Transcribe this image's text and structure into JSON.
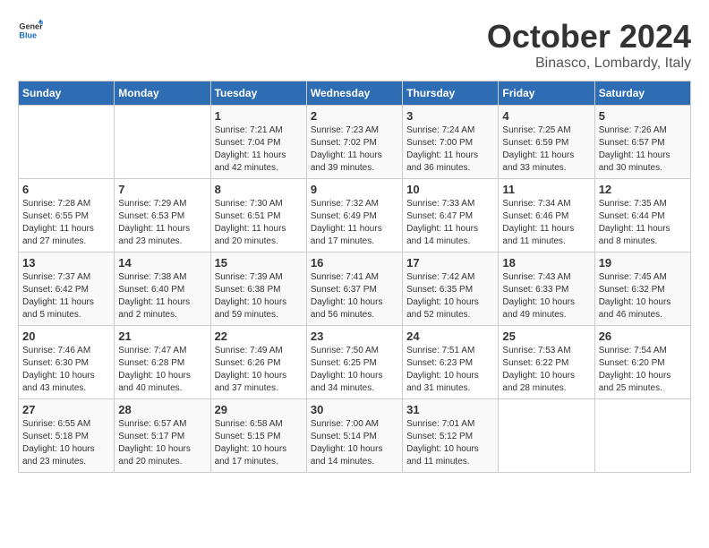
{
  "header": {
    "logo_general": "General",
    "logo_blue": "Blue",
    "month": "October 2024",
    "location": "Binasco, Lombardy, Italy"
  },
  "days_of_week": [
    "Sunday",
    "Monday",
    "Tuesday",
    "Wednesday",
    "Thursday",
    "Friday",
    "Saturday"
  ],
  "weeks": [
    [
      {
        "day": "",
        "info": ""
      },
      {
        "day": "",
        "info": ""
      },
      {
        "day": "1",
        "info": "Sunrise: 7:21 AM\nSunset: 7:04 PM\nDaylight: 11 hours and 42 minutes."
      },
      {
        "day": "2",
        "info": "Sunrise: 7:23 AM\nSunset: 7:02 PM\nDaylight: 11 hours and 39 minutes."
      },
      {
        "day": "3",
        "info": "Sunrise: 7:24 AM\nSunset: 7:00 PM\nDaylight: 11 hours and 36 minutes."
      },
      {
        "day": "4",
        "info": "Sunrise: 7:25 AM\nSunset: 6:59 PM\nDaylight: 11 hours and 33 minutes."
      },
      {
        "day": "5",
        "info": "Sunrise: 7:26 AM\nSunset: 6:57 PM\nDaylight: 11 hours and 30 minutes."
      }
    ],
    [
      {
        "day": "6",
        "info": "Sunrise: 7:28 AM\nSunset: 6:55 PM\nDaylight: 11 hours and 27 minutes."
      },
      {
        "day": "7",
        "info": "Sunrise: 7:29 AM\nSunset: 6:53 PM\nDaylight: 11 hours and 23 minutes."
      },
      {
        "day": "8",
        "info": "Sunrise: 7:30 AM\nSunset: 6:51 PM\nDaylight: 11 hours and 20 minutes."
      },
      {
        "day": "9",
        "info": "Sunrise: 7:32 AM\nSunset: 6:49 PM\nDaylight: 11 hours and 17 minutes."
      },
      {
        "day": "10",
        "info": "Sunrise: 7:33 AM\nSunset: 6:47 PM\nDaylight: 11 hours and 14 minutes."
      },
      {
        "day": "11",
        "info": "Sunrise: 7:34 AM\nSunset: 6:46 PM\nDaylight: 11 hours and 11 minutes."
      },
      {
        "day": "12",
        "info": "Sunrise: 7:35 AM\nSunset: 6:44 PM\nDaylight: 11 hours and 8 minutes."
      }
    ],
    [
      {
        "day": "13",
        "info": "Sunrise: 7:37 AM\nSunset: 6:42 PM\nDaylight: 11 hours and 5 minutes."
      },
      {
        "day": "14",
        "info": "Sunrise: 7:38 AM\nSunset: 6:40 PM\nDaylight: 11 hours and 2 minutes."
      },
      {
        "day": "15",
        "info": "Sunrise: 7:39 AM\nSunset: 6:38 PM\nDaylight: 10 hours and 59 minutes."
      },
      {
        "day": "16",
        "info": "Sunrise: 7:41 AM\nSunset: 6:37 PM\nDaylight: 10 hours and 56 minutes."
      },
      {
        "day": "17",
        "info": "Sunrise: 7:42 AM\nSunset: 6:35 PM\nDaylight: 10 hours and 52 minutes."
      },
      {
        "day": "18",
        "info": "Sunrise: 7:43 AM\nSunset: 6:33 PM\nDaylight: 10 hours and 49 minutes."
      },
      {
        "day": "19",
        "info": "Sunrise: 7:45 AM\nSunset: 6:32 PM\nDaylight: 10 hours and 46 minutes."
      }
    ],
    [
      {
        "day": "20",
        "info": "Sunrise: 7:46 AM\nSunset: 6:30 PM\nDaylight: 10 hours and 43 minutes."
      },
      {
        "day": "21",
        "info": "Sunrise: 7:47 AM\nSunset: 6:28 PM\nDaylight: 10 hours and 40 minutes."
      },
      {
        "day": "22",
        "info": "Sunrise: 7:49 AM\nSunset: 6:26 PM\nDaylight: 10 hours and 37 minutes."
      },
      {
        "day": "23",
        "info": "Sunrise: 7:50 AM\nSunset: 6:25 PM\nDaylight: 10 hours and 34 minutes."
      },
      {
        "day": "24",
        "info": "Sunrise: 7:51 AM\nSunset: 6:23 PM\nDaylight: 10 hours and 31 minutes."
      },
      {
        "day": "25",
        "info": "Sunrise: 7:53 AM\nSunset: 6:22 PM\nDaylight: 10 hours and 28 minutes."
      },
      {
        "day": "26",
        "info": "Sunrise: 7:54 AM\nSunset: 6:20 PM\nDaylight: 10 hours and 25 minutes."
      }
    ],
    [
      {
        "day": "27",
        "info": "Sunrise: 6:55 AM\nSunset: 5:18 PM\nDaylight: 10 hours and 23 minutes."
      },
      {
        "day": "28",
        "info": "Sunrise: 6:57 AM\nSunset: 5:17 PM\nDaylight: 10 hours and 20 minutes."
      },
      {
        "day": "29",
        "info": "Sunrise: 6:58 AM\nSunset: 5:15 PM\nDaylight: 10 hours and 17 minutes."
      },
      {
        "day": "30",
        "info": "Sunrise: 7:00 AM\nSunset: 5:14 PM\nDaylight: 10 hours and 14 minutes."
      },
      {
        "day": "31",
        "info": "Sunrise: 7:01 AM\nSunset: 5:12 PM\nDaylight: 10 hours and 11 minutes."
      },
      {
        "day": "",
        "info": ""
      },
      {
        "day": "",
        "info": ""
      }
    ]
  ]
}
